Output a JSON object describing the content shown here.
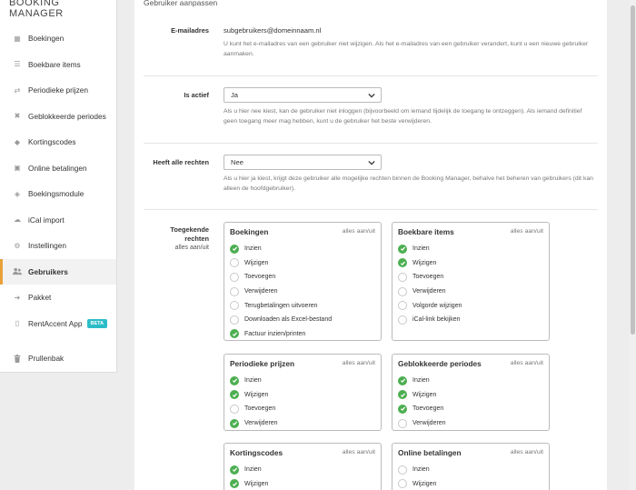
{
  "brand": "BOOKING MANAGER",
  "nav": [
    {
      "label": "Boekingen",
      "icon": "calendar-icon",
      "glyph": "▦"
    },
    {
      "label": "Boekbare items",
      "icon": "list-icon",
      "glyph": "☰"
    },
    {
      "label": "Periodieke prijzen",
      "icon": "exchange-icon",
      "glyph": "⇄"
    },
    {
      "label": "Geblokkeerde periodes",
      "icon": "x-icon",
      "glyph": "✖"
    },
    {
      "label": "Kortingscodes",
      "icon": "tags-icon",
      "glyph": "◆"
    },
    {
      "label": "Online betalingen",
      "icon": "money-icon",
      "glyph": "▣"
    },
    {
      "label": "Boekingsmodule",
      "icon": "cube-icon",
      "glyph": "◈"
    },
    {
      "label": "iCal import",
      "icon": "cloud-download-icon",
      "glyph": "☁"
    },
    {
      "label": "Instellingen",
      "icon": "gear-icon",
      "glyph": "⚙"
    },
    {
      "label": "Gebruikers",
      "icon": "users-icon",
      "glyph": "👥"
    },
    {
      "label": "Pakket",
      "icon": "arrow-right-icon",
      "glyph": "➜"
    },
    {
      "label": "RentAccent App",
      "icon": "mobile-icon",
      "glyph": "▯",
      "badge": "BETA"
    },
    {
      "label": "Prullenbak",
      "icon": "trash-icon",
      "glyph": "🗑"
    }
  ],
  "card_title": "Gebruiker aanpassen",
  "email": {
    "label": "E-mailadres",
    "value": "subgebruikers@domeinnaam.nl",
    "help": "U kunt het e-mailadres van een gebruiker niet wijzigen. Als het e-mailadres van een gebruiker verandert, kunt u een nieuwe gebruiker aanmaken."
  },
  "active": {
    "label": "Is actief",
    "value": "Ja",
    "help": "Als u hier nee kiest, kan de gebruiker niet inloggen (bijvoorbeeld om iemand tijdelijk de toegang te ontzeggen). Als iemand definitief geen toegang meer mag hebben, kunt u de gebruiker het beste verwijderen."
  },
  "allrights": {
    "label": "Heeft alle rechten",
    "value": "Nee",
    "help": "Als u hier ja kiest, krijgt deze gebruiker alle mogelijke rechten binnen de Booking Manager, behalve het beheren van gebruikers (dit kan alleen de hoofdgebruiker)."
  },
  "granted": {
    "label_line1": "Toegekende",
    "label_line2": "rechten",
    "toggle_all": "alles aan/uit"
  },
  "toggle": "alles aan/uit",
  "boxes": [
    {
      "title": "Boekingen",
      "items": [
        {
          "label": "Inzien",
          "on": true
        },
        {
          "label": "Wijzigen",
          "on": false
        },
        {
          "label": "Toevoegen",
          "on": false
        },
        {
          "label": "Verwijderen",
          "on": false
        },
        {
          "label": "Terugbetalingen uitvoeren",
          "on": false
        },
        {
          "label": "Downloaden als Excel-bestand",
          "on": false
        },
        {
          "label": "Factuur inzien/printen",
          "on": true
        }
      ]
    },
    {
      "title": "Boekbare items",
      "items": [
        {
          "label": "Inzien",
          "on": true
        },
        {
          "label": "Wijzigen",
          "on": true
        },
        {
          "label": "Toevoegen",
          "on": false
        },
        {
          "label": "Verwijderen",
          "on": false
        },
        {
          "label": "Volgorde wijzigen",
          "on": false
        },
        {
          "label": "iCal-link bekijken",
          "on": false
        }
      ]
    },
    {
      "title": "Periodieke prijzen",
      "items": [
        {
          "label": "Inzien",
          "on": true
        },
        {
          "label": "Wijzigen",
          "on": true
        },
        {
          "label": "Toevoegen",
          "on": false
        },
        {
          "label": "Verwijderen",
          "on": true
        }
      ]
    },
    {
      "title": "Geblokkeerde periodes",
      "items": [
        {
          "label": "Inzien",
          "on": true
        },
        {
          "label": "Wijzigen",
          "on": true
        },
        {
          "label": "Toevoegen",
          "on": true
        },
        {
          "label": "Verwijderen",
          "on": false
        }
      ]
    },
    {
      "title": "Kortingscodes",
      "items": [
        {
          "label": "Inzien",
          "on": true
        },
        {
          "label": "Wijzigen",
          "on": true
        }
      ]
    },
    {
      "title": "Online betalingen",
      "items": [
        {
          "label": "Inzien",
          "on": false
        },
        {
          "label": "Wijzigen",
          "on": false
        }
      ]
    }
  ],
  "colors": {
    "accent": "#e8a13a",
    "check": "#4caf50",
    "beta": "#2bbdc7"
  }
}
